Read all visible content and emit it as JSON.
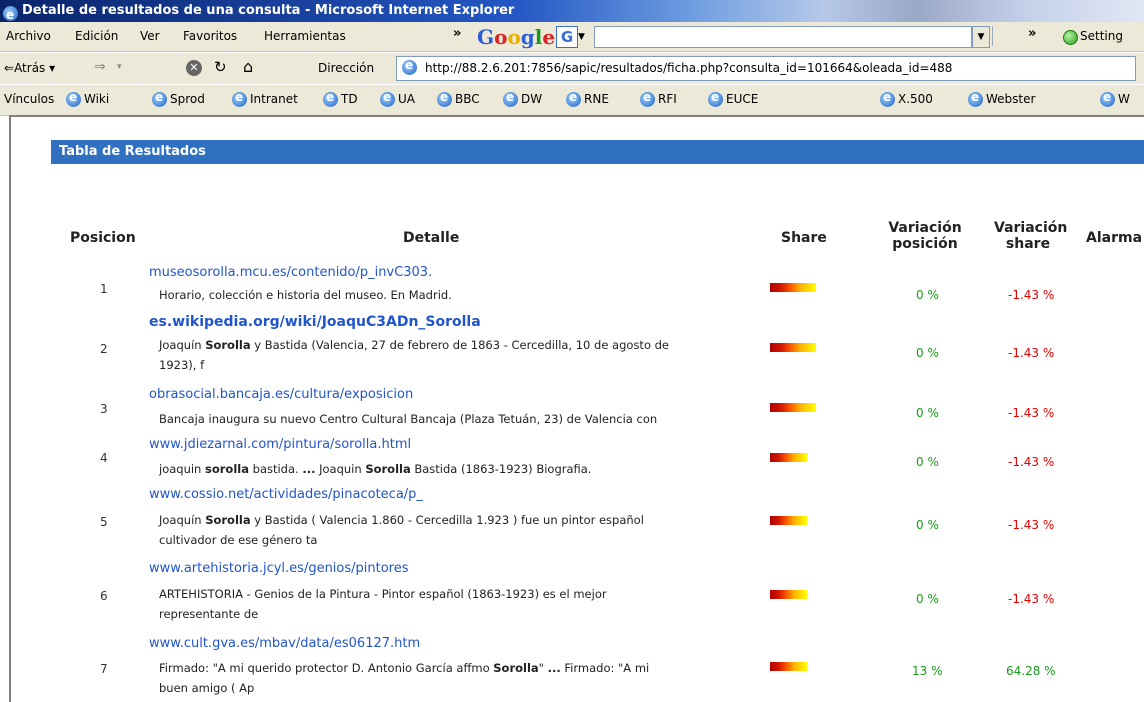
{
  "window": {
    "title": "Detalle de resultados de una consulta - Microsoft Internet Explorer"
  },
  "menu": {
    "items": [
      "Archivo",
      "Edición",
      "Ver",
      "Favoritos",
      "Herramientas"
    ],
    "chevron": "»",
    "settings_label": "Setting"
  },
  "google_toolbar": {
    "logo": [
      "G",
      "o",
      "o",
      "g",
      "l",
      "e"
    ],
    "g_button": "G"
  },
  "nav": {
    "back_label": "Atrás",
    "address_label": "Dirección",
    "url": "http://88.2.6.201:7856/sapic/resultados/ficha.php?consulta_id=101664&oleada_id=488"
  },
  "links": {
    "label": "Vínculos",
    "items": [
      "Wiki",
      "Sprod",
      "Intranet",
      "TD",
      "UA",
      "BBC",
      "DW",
      "RNE",
      "RFI",
      "EUCE",
      "X.500",
      "Webster",
      "W"
    ]
  },
  "results": {
    "section_title": "Tabla de Resultados",
    "columns": {
      "posicion": "Posicion",
      "detalle": "Detalle",
      "share": "Share",
      "var_pos_1": "Variación",
      "var_pos_2": "posición",
      "var_share_1": "Variación",
      "var_share_2": "share",
      "alarma": "Alarma"
    },
    "rows": [
      {
        "pos": "1",
        "url": "museosorolla.mcu.es/contenido/p_invC303.",
        "snippet": [
          "Horario, colección e historia del museo. En Madrid."
        ],
        "var_pos": "0 %",
        "var_share": "-1.43 %"
      },
      {
        "pos": "2",
        "url": "es.wikipedia.org/wiki/JoaquC3ADn_Sorolla",
        "snippet": [
          "Joaquín **Sorolla** y Bastida (Valencia, 27 de febrero de 1863 - Cercedilla, 10 de agosto de",
          "1923), f"
        ],
        "var_pos": "0 %",
        "var_share": "-1.43 %"
      },
      {
        "pos": "3",
        "url": "obrasocial.bancaja.es/cultura/exposicion",
        "snippet": [
          "Bancaja inaugura su nuevo Centro Cultural Bancaja (Plaza Tetuán, 23) de Valencia con"
        ],
        "var_pos": "0 %",
        "var_share": "-1.43 %"
      },
      {
        "pos": "4",
        "url": "www.jdiezarnal.com/pintura/sorolla.html",
        "snippet": [
          "joaquin **sorolla** bastida. **...** Joaquin **Sorolla** Bastida (1863-1923) Biografia."
        ],
        "var_pos": "0 %",
        "var_share": "-1.43 %"
      },
      {
        "pos": "5",
        "url": "www.cossio.net/actividades/pinacoteca/p_",
        "snippet": [
          "Joaquín **Sorolla** y Bastida ( Valencia 1.860 - Cercedilla 1.923 ) fue un pintor español",
          "cultivador de ese género ta"
        ],
        "var_pos": "0 %",
        "var_share": "-1.43 %"
      },
      {
        "pos": "6",
        "url": "www.artehistoria.jcyl.es/genios/pintores",
        "snippet": [
          "ARTEHISTORIA - Genios de la Pintura - Pintor español (1863-1923) es el mejor",
          "representante de"
        ],
        "var_pos": "0 %",
        "var_share": "-1.43 %"
      },
      {
        "pos": "7",
        "url": "www.cult.gva.es/mbav/data/es06127.htm",
        "snippet": [
          "Firmado: \"A mi querido protector D. Antonio García affmo **Sorolla**\" **...** Firmado: \"A mi",
          "buen amigo ( Ap"
        ],
        "var_pos": "13 %",
        "var_share": "64.28 %"
      }
    ]
  }
}
